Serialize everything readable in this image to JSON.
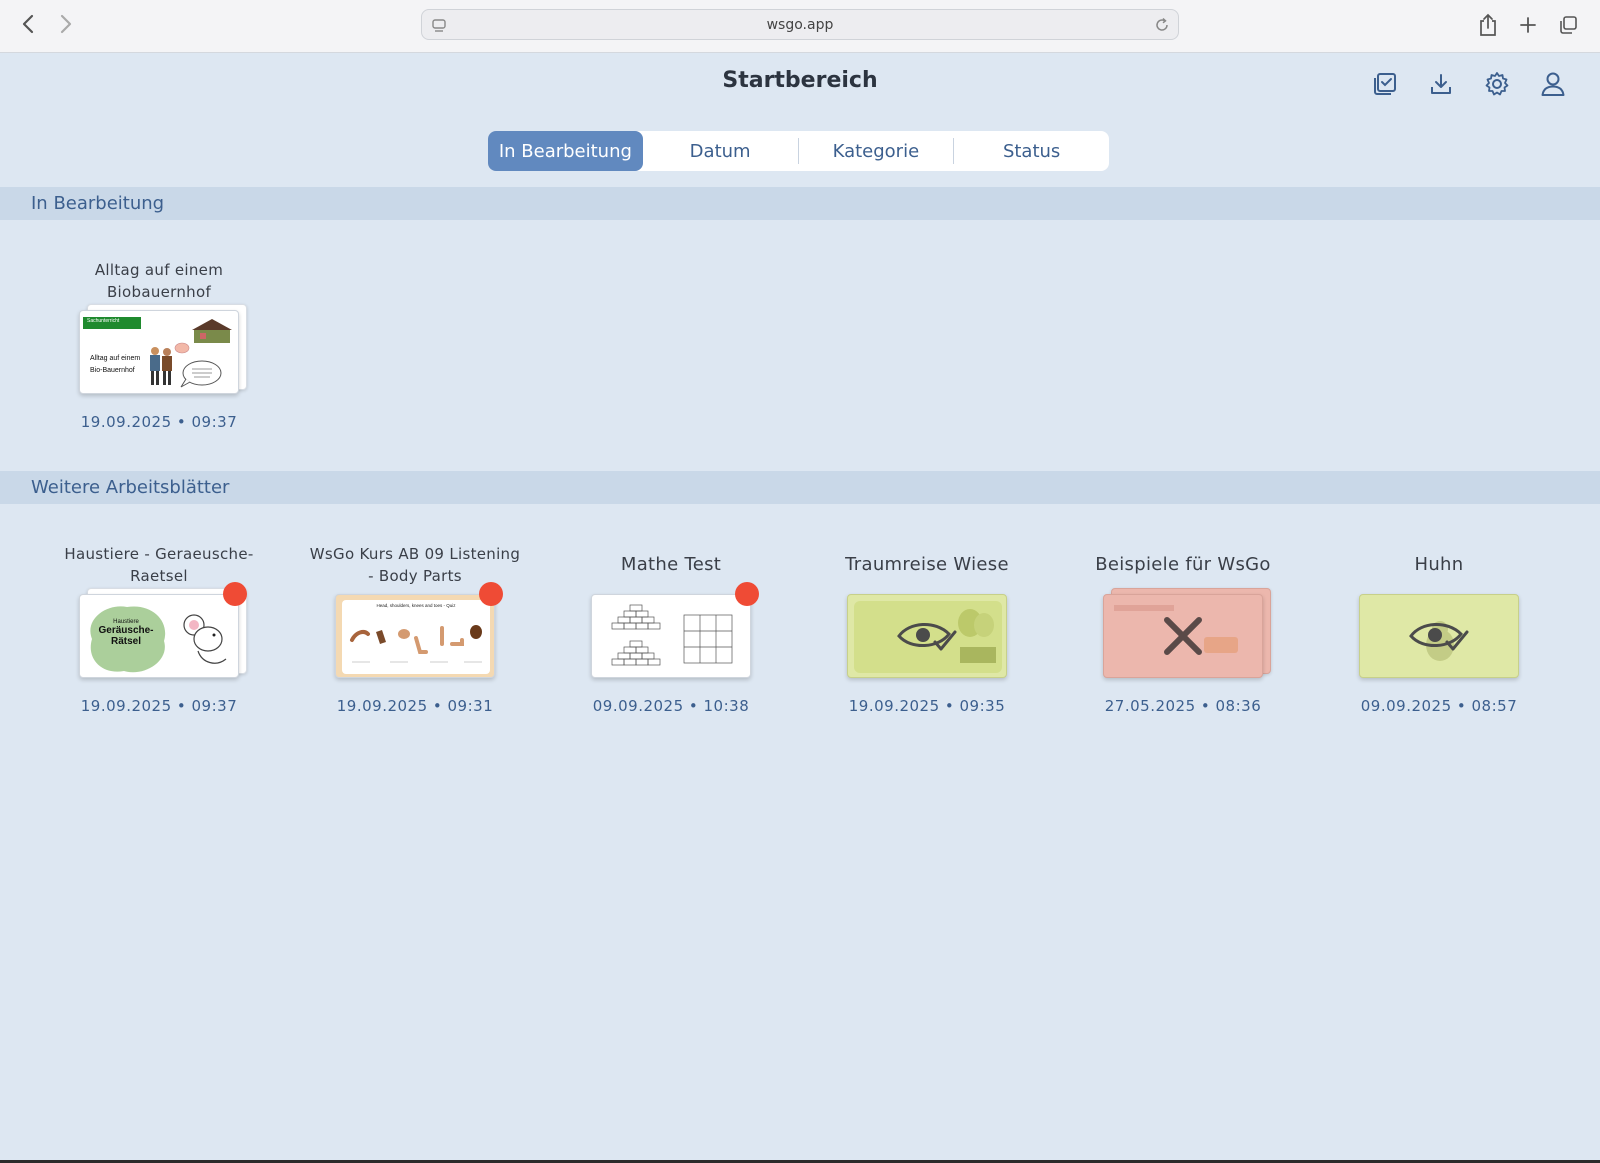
{
  "browser": {
    "url": "wsgo.app"
  },
  "header": {
    "title": "Startbereich",
    "icons": [
      "checklist-icon",
      "download-icon",
      "gear-icon",
      "user-icon"
    ]
  },
  "tabs": [
    {
      "label": "In Bearbeitung",
      "active": true
    },
    {
      "label": "Datum",
      "active": false
    },
    {
      "label": "Kategorie",
      "active": false
    },
    {
      "label": "Status",
      "active": false
    }
  ],
  "sections": {
    "in_progress": {
      "label": "In Bearbeitung",
      "items": [
        {
          "title": "Alltag auf einem Biobauernhof",
          "date": "19.09.2025 • 09:37",
          "thumb_texts": [
            "Sachunterricht",
            "Alltag auf einem",
            "Bio-Bauernhof"
          ]
        }
      ]
    },
    "more": {
      "label": "Weitere Arbeitsblätter",
      "items": [
        {
          "title": "Haustiere - Geraeusche-Raetsel",
          "date": "19.09.2025 • 09:37",
          "badge": true,
          "thumb_texts": [
            "Haustiere",
            "Geräusche-",
            "Rätsel"
          ]
        },
        {
          "title": "WsGo Kurs AB 09 Listening - Body Parts",
          "date": "19.09.2025 • 09:31",
          "badge": true,
          "thumb_texts": [
            "Head, shoulders, knees and toes - Quiz"
          ]
        },
        {
          "title": "Mathe Test",
          "date": "09.09.2025 • 10:38",
          "badge": true
        },
        {
          "title": "Traumreise Wiese",
          "date": "19.09.2025 • 09:35",
          "overlay": "eye-check-icon"
        },
        {
          "title": "Beispiele für WsGo",
          "date": "27.05.2025 • 08:36",
          "overlay": "close-x-icon"
        },
        {
          "title": "Huhn",
          "date": "09.09.2025 • 08:57",
          "overlay": "eye-check-icon"
        }
      ]
    }
  },
  "colors": {
    "background": "#dde7f2",
    "accent": "#6189bf",
    "section_bar": "#c9d8e8",
    "badge": "#ef4b35"
  }
}
